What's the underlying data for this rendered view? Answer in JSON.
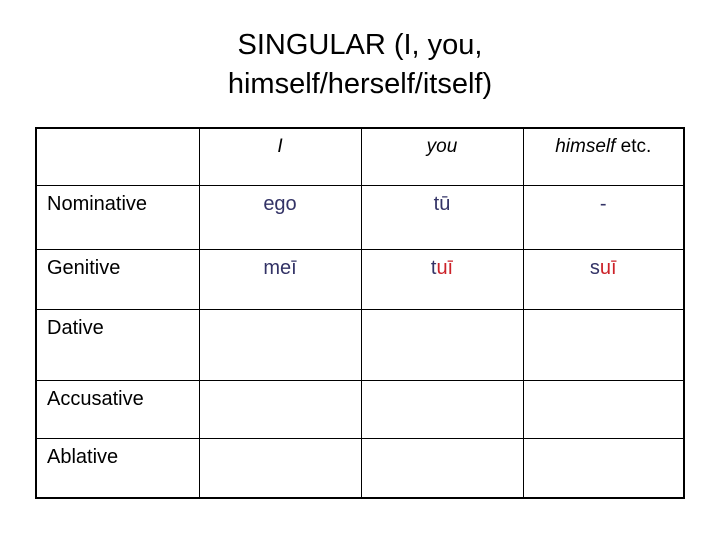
{
  "slide": {
    "title_lines": [
      "SINGULAR (I, you,",
      "himself/herself/itself)"
    ],
    "colors": {
      "background": "#ffffff",
      "text": "#000000",
      "navy": "#333366",
      "red": "#cc2229",
      "border": "#000000"
    }
  },
  "table": {
    "columns": [
      {
        "key": "case",
        "label": "",
        "style": "blank"
      },
      {
        "key": "ego",
        "label": "I",
        "style": "italic"
      },
      {
        "key": "tu",
        "label": "you",
        "style": "italic"
      },
      {
        "key": "sui",
        "label_italic": "himself",
        "label_roman": " etc.",
        "style": "mixed"
      }
    ],
    "rows": [
      {
        "case": "Nominative",
        "ego": {
          "text": "ego",
          "color": "navy"
        },
        "tu": {
          "text": "tū",
          "color": "navy"
        },
        "sui": {
          "text": "-",
          "color": "navy"
        }
      },
      {
        "case": "Genitive",
        "ego": {
          "text": "meī",
          "color": "navy"
        },
        "tu": {
          "navy_part": "t",
          "red_part": "uī"
        },
        "sui": {
          "navy_part": "s",
          "red_part": "uī"
        }
      },
      {
        "case": "Dative",
        "ego": {
          "text": ""
        },
        "tu": {
          "text": ""
        },
        "sui": {
          "text": ""
        }
      },
      {
        "case": "Accusative",
        "ego": {
          "text": ""
        },
        "tu": {
          "text": ""
        },
        "sui": {
          "text": ""
        }
      },
      {
        "case": "Ablative",
        "ego": {
          "text": ""
        },
        "tu": {
          "text": ""
        },
        "sui": {
          "text": ""
        }
      }
    ]
  }
}
